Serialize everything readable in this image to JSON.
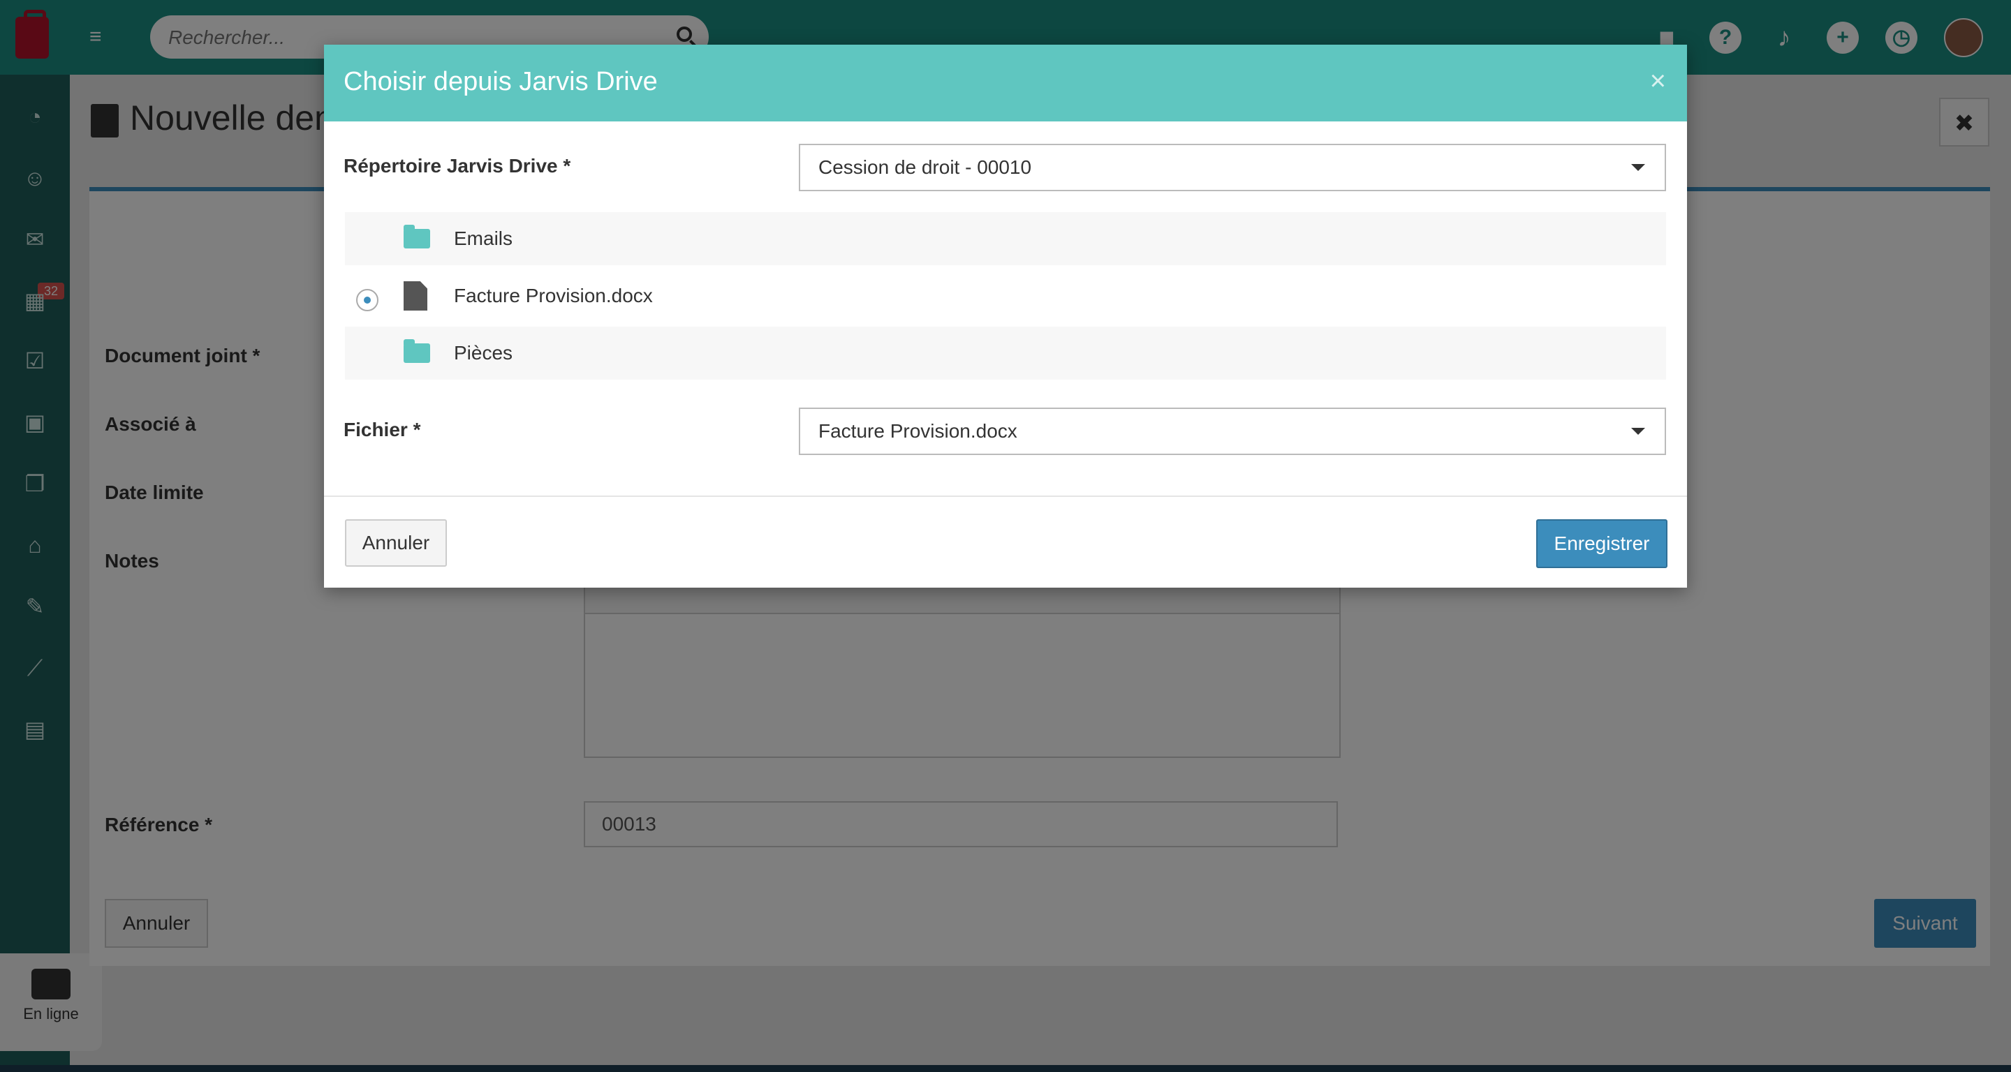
{
  "topbar": {
    "search_placeholder": "Rechercher...",
    "icons": [
      "menu-icon",
      "search-icon",
      "video-icon",
      "help-icon",
      "bell-icon",
      "plus-icon",
      "clock-icon",
      "avatar"
    ]
  },
  "sidebar": {
    "mail_badge": "32",
    "chat_status": "En ligne"
  },
  "page": {
    "title": "Nouvelle den",
    "labels": {
      "document": "Document joint *",
      "associe": "Associé à",
      "date": "Date limite",
      "notes": "Notes",
      "reference": "Référence *"
    },
    "reference_value": "00013",
    "cancel_label": "Annuler",
    "next_label": "Suivant"
  },
  "modal": {
    "title": "Choisir depuis Jarvis Drive",
    "close_label": "×",
    "folder_label": "Répertoire Jarvis Drive *",
    "folder_value": "Cession de droit - 00010",
    "tree": [
      {
        "name": "Emails",
        "type": "folder"
      },
      {
        "name": "Facture Provision.docx",
        "type": "file",
        "selected": true
      },
      {
        "name": "Pièces",
        "type": "folder"
      }
    ],
    "file_label": "Fichier *",
    "file_value": "Facture Provision.docx",
    "cancel_label": "Annuler",
    "save_label": "Enregistrer"
  },
  "colors": {
    "modal_header": "#5fc6c0",
    "topbar": "#1b8f82",
    "primary_button": "#3c8dbc"
  }
}
